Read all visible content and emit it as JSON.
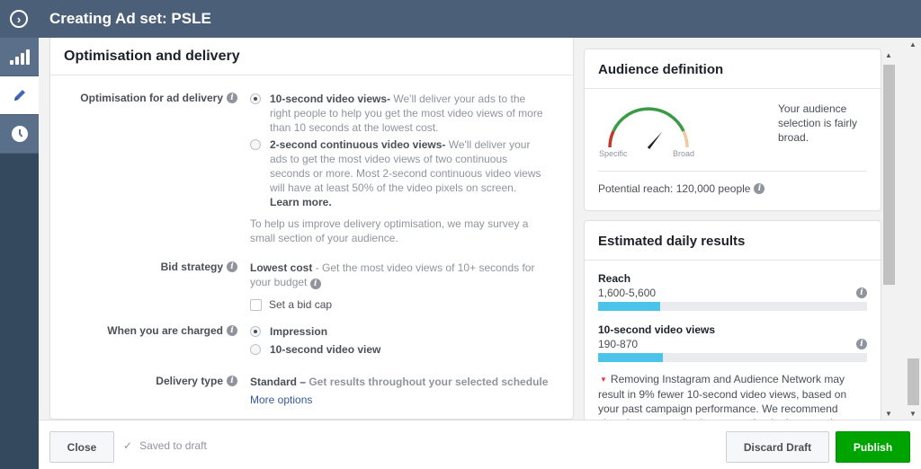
{
  "header": {
    "title": "Creating Ad set: PSLE",
    "toggle_icon": "chevron-right-circle-icon"
  },
  "rail": [
    {
      "icon": "bar-chart-icon",
      "active": false
    },
    {
      "icon": "pencil-icon",
      "active": true
    },
    {
      "icon": "clock-icon",
      "active": false
    }
  ],
  "section": {
    "title": "Optimisation and delivery",
    "optimisation": {
      "label": "Optimisation for ad delivery",
      "options": [
        {
          "title": "10-second video views-",
          "desc": " We'll deliver your ads to the right people to help you get the most video views of more than 10 seconds at the lowest cost.",
          "selected": true
        },
        {
          "title": "2-second continuous video views-",
          "desc": " We'll deliver your ads to get the most video views of two continuous seconds or more. Most 2-second continuous video views will have at least 50% of the video pixels on screen. ",
          "link": "Learn more.",
          "selected": false
        }
      ],
      "note": "To help us improve delivery optimisation, we may survey a small section of your audience."
    },
    "bid": {
      "label": "Bid strategy",
      "value": "Lowest cost",
      "desc": " - Get the most video views of 10+ seconds for your budget",
      "checkbox_label": "Set a bid cap",
      "checkbox_checked": false
    },
    "charged": {
      "label": "When you are charged",
      "options": [
        {
          "label": "Impression",
          "selected": true
        },
        {
          "label": "10-second video view",
          "selected": false
        }
      ]
    },
    "delivery": {
      "label": "Delivery type",
      "value": "Standard –",
      "desc": " Get results throughout your selected schedule",
      "more": "More options"
    }
  },
  "audience": {
    "title": "Audience definition",
    "gauge_specific": "Specific",
    "gauge_broad": "Broad",
    "gauge_level": 0.72,
    "text": "Your audience selection is fairly broad.",
    "potential_reach": "Potential reach: 120,000 people"
  },
  "estimated": {
    "title": "Estimated daily results",
    "metrics": [
      {
        "title": "Reach",
        "value": "1,600-5,600",
        "fill": 0.23
      },
      {
        "title": "10-second video views",
        "value": "190-870",
        "fill": 0.24
      }
    ],
    "warning": "Removing Instagram and Audience Network may result in 9% fewer 10-second video views, based on your past campaign performance. We recommend choosing automatic placements for the best results."
  },
  "footer": {
    "close": "Close",
    "saved": "Saved to draft",
    "discard": "Discard Draft",
    "publish": "Publish",
    "publish_color": "#00a400"
  }
}
